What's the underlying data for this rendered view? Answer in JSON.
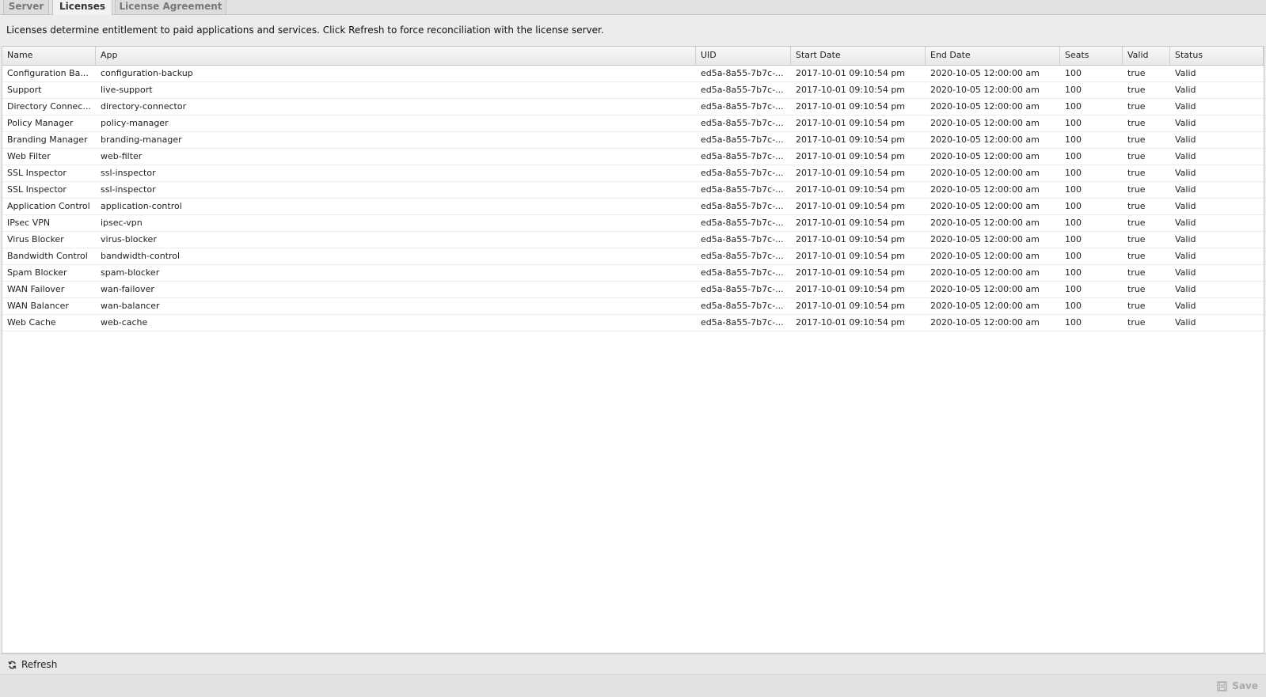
{
  "tabs": [
    {
      "label": "Server",
      "active": false
    },
    {
      "label": "Licenses",
      "active": true
    },
    {
      "label": "License Agreement",
      "active": false
    }
  ],
  "description": "Licenses determine entitlement to paid applications and services. Click Refresh to force reconciliation with the license server.",
  "grid": {
    "columns": [
      "Name",
      "App",
      "UID",
      "Start Date",
      "End Date",
      "Seats",
      "Valid",
      "Status"
    ],
    "rows": [
      [
        "Configuration Ba...",
        "configuration-backup",
        "ed5a-8a55-7b7c-...",
        "2017-10-01 09:10:54 pm",
        "2020-10-05 12:00:00 am",
        "100",
        "true",
        "Valid"
      ],
      [
        "Support",
        "live-support",
        "ed5a-8a55-7b7c-...",
        "2017-10-01 09:10:54 pm",
        "2020-10-05 12:00:00 am",
        "100",
        "true",
        "Valid"
      ],
      [
        "Directory Connec...",
        "directory-connector",
        "ed5a-8a55-7b7c-...",
        "2017-10-01 09:10:54 pm",
        "2020-10-05 12:00:00 am",
        "100",
        "true",
        "Valid"
      ],
      [
        "Policy Manager",
        "policy-manager",
        "ed5a-8a55-7b7c-...",
        "2017-10-01 09:10:54 pm",
        "2020-10-05 12:00:00 am",
        "100",
        "true",
        "Valid"
      ],
      [
        "Branding Manager",
        "branding-manager",
        "ed5a-8a55-7b7c-...",
        "2017-10-01 09:10:54 pm",
        "2020-10-05 12:00:00 am",
        "100",
        "true",
        "Valid"
      ],
      [
        "Web Filter",
        "web-filter",
        "ed5a-8a55-7b7c-...",
        "2017-10-01 09:10:54 pm",
        "2020-10-05 12:00:00 am",
        "100",
        "true",
        "Valid"
      ],
      [
        "SSL Inspector",
        "ssl-inspector",
        "ed5a-8a55-7b7c-...",
        "2017-10-01 09:10:54 pm",
        "2020-10-05 12:00:00 am",
        "100",
        "true",
        "Valid"
      ],
      [
        "SSL Inspector",
        "ssl-inspector",
        "ed5a-8a55-7b7c-...",
        "2017-10-01 09:10:54 pm",
        "2020-10-05 12:00:00 am",
        "100",
        "true",
        "Valid"
      ],
      [
        "Application Control",
        "application-control",
        "ed5a-8a55-7b7c-...",
        "2017-10-01 09:10:54 pm",
        "2020-10-05 12:00:00 am",
        "100",
        "true",
        "Valid"
      ],
      [
        "IPsec VPN",
        "ipsec-vpn",
        "ed5a-8a55-7b7c-...",
        "2017-10-01 09:10:54 pm",
        "2020-10-05 12:00:00 am",
        "100",
        "true",
        "Valid"
      ],
      [
        "Virus Blocker",
        "virus-blocker",
        "ed5a-8a55-7b7c-...",
        "2017-10-01 09:10:54 pm",
        "2020-10-05 12:00:00 am",
        "100",
        "true",
        "Valid"
      ],
      [
        "Bandwidth Control",
        "bandwidth-control",
        "ed5a-8a55-7b7c-...",
        "2017-10-01 09:10:54 pm",
        "2020-10-05 12:00:00 am",
        "100",
        "true",
        "Valid"
      ],
      [
        "Spam Blocker",
        "spam-blocker",
        "ed5a-8a55-7b7c-...",
        "2017-10-01 09:10:54 pm",
        "2020-10-05 12:00:00 am",
        "100",
        "true",
        "Valid"
      ],
      [
        "WAN Failover",
        "wan-failover",
        "ed5a-8a55-7b7c-...",
        "2017-10-01 09:10:54 pm",
        "2020-10-05 12:00:00 am",
        "100",
        "true",
        "Valid"
      ],
      [
        "WAN Balancer",
        "wan-balancer",
        "ed5a-8a55-7b7c-...",
        "2017-10-01 09:10:54 pm",
        "2020-10-05 12:00:00 am",
        "100",
        "true",
        "Valid"
      ],
      [
        "Web Cache",
        "web-cache",
        "ed5a-8a55-7b7c-...",
        "2017-10-01 09:10:54 pm",
        "2020-10-05 12:00:00 am",
        "100",
        "true",
        "Valid"
      ]
    ]
  },
  "toolbar": {
    "refresh_label": "Refresh",
    "refresh_icon": "refresh-icon"
  },
  "footer": {
    "save_label": "Save",
    "save_icon": "save-icon"
  }
}
